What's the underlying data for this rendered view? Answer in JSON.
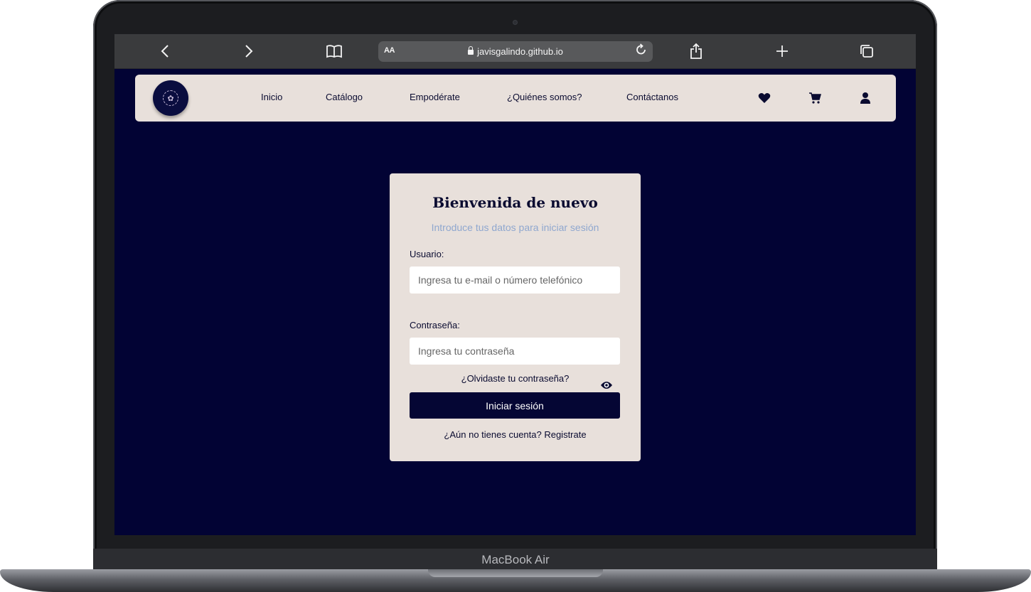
{
  "device": {
    "label": "MacBook Air"
  },
  "browser": {
    "back_glyph": "‹",
    "forward_glyph": "›",
    "text_size_label": "AA",
    "url": "javisgalindo.github.io",
    "icons": [
      "back-icon",
      "forward-icon",
      "bookmarks-icon",
      "lock-icon",
      "reload-icon",
      "share-icon",
      "new-tab-icon",
      "tabs-icon"
    ]
  },
  "nav": {
    "links": [
      "Inicio",
      "Catálogo",
      "Empodérate",
      "¿Quiénes somos?",
      "Contáctanos"
    ],
    "icons": [
      "heart-icon",
      "cart-icon",
      "user-icon"
    ]
  },
  "login": {
    "title": "Bienvenida de nuevo",
    "subtitle": "Introduce tus datos para iniciar sesión",
    "user_label": "Usuario:",
    "user_placeholder": "Ingresa tu e-mail o número telefónico",
    "password_label": "Contraseña:",
    "password_placeholder": "Ingresa tu contraseña",
    "forgot": "¿Olvidaste tu contraseña?",
    "submit": "Iniciar sesión",
    "register": "¿Aún no tienes cuenta? Registrate"
  },
  "colors": {
    "page_bg": "#020334",
    "nav_bg": "#e8e0db",
    "card_bg": "#e8e0db",
    "primary": "#050634",
    "subtitle": "#8fa7cf"
  }
}
